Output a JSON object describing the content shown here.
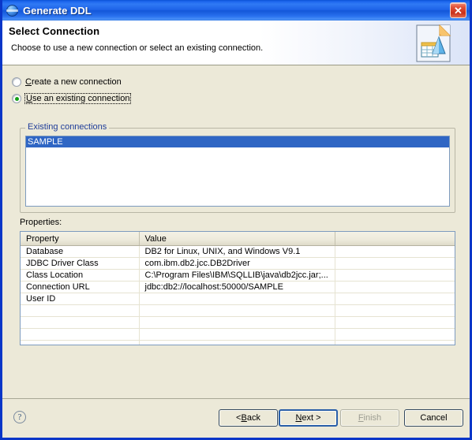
{
  "window": {
    "title": "Generate DDL",
    "icon": "eclipse-sphere-icon",
    "close_label": "✕"
  },
  "header": {
    "title": "Select Connection",
    "subtitle": "Choose to use a new connection or select an existing connection.",
    "icon": "ddl-document-icon"
  },
  "options": {
    "create_new": {
      "label_before": "",
      "mnemonic": "C",
      "label_after": "reate a new connection",
      "selected": false
    },
    "use_existing": {
      "label_before": "",
      "mnemonic": "U",
      "label_after": "se an existing connection",
      "selected": true
    }
  },
  "existing_connections": {
    "group_title": "Existing connections",
    "items": [
      {
        "name": "SAMPLE",
        "selected": true
      }
    ]
  },
  "properties": {
    "label": "Properties:",
    "columns": [
      "Property",
      "Value",
      ""
    ],
    "rows": [
      {
        "property": "Database",
        "value": "DB2 for Linux, UNIX, and Windows V9.1",
        "extra": ""
      },
      {
        "property": "JDBC Driver Class",
        "value": "com.ibm.db2.jcc.DB2Driver",
        "extra": ""
      },
      {
        "property": "Class Location",
        "value": "C:\\Program Files\\IBM\\SQLLIB\\java\\db2jcc.jar;...",
        "extra": ""
      },
      {
        "property": "Connection URL",
        "value": "jdbc:db2://localhost:50000/SAMPLE",
        "extra": ""
      },
      {
        "property": "User ID",
        "value": "",
        "extra": ""
      },
      {
        "property": "",
        "value": "",
        "extra": ""
      },
      {
        "property": "",
        "value": "",
        "extra": ""
      },
      {
        "property": "",
        "value": "",
        "extra": ""
      },
      {
        "property": "",
        "value": "",
        "extra": ""
      }
    ]
  },
  "buttons": {
    "help": "?",
    "back": {
      "prefix": "< ",
      "mnemonic": "B",
      "suffix": "ack",
      "enabled": true
    },
    "next": {
      "prefix": "",
      "mnemonic": "N",
      "suffix": "ext >",
      "enabled": true,
      "default": true
    },
    "finish": {
      "prefix": "",
      "mnemonic": "F",
      "suffix": "inish",
      "enabled": false
    },
    "cancel": {
      "prefix": "",
      "mnemonic": "",
      "suffix": "Cancel",
      "enabled": true
    }
  },
  "colors": {
    "titlebar_blue": "#1d63e8",
    "dialog_border": "#0a36c8",
    "background": "#ece9d8",
    "selection_blue": "#2f66c4",
    "group_label": "#1f3d99",
    "close_red": "#c9301a",
    "radio_dot_green": "#15a018"
  }
}
